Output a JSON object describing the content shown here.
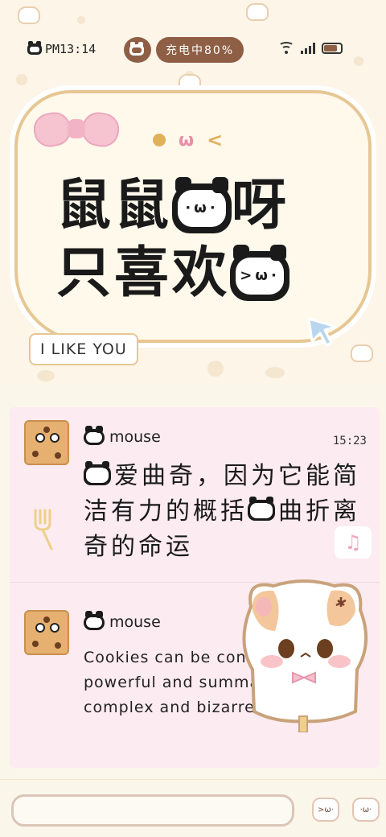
{
  "status_bar": {
    "time": "PM13:14",
    "charging": "充电中80%",
    "battery_level": 0.8
  },
  "header": {
    "title_line1": "鼠鼠",
    "title_line1_suffix": "呀",
    "title_line2": "只喜欢",
    "subtitle": "I LIKE YOU"
  },
  "chat": {
    "messages": [
      {
        "sender": "mouse",
        "time": "15:23",
        "text_part1": "爱曲奇，因为它能简洁有力的概括",
        "text_part2": "曲折离奇的命运"
      },
      {
        "sender": "mouse",
        "text": "Cookies can be concise and powerful and summarize my complex and bizarre destiny"
      }
    ]
  },
  "input": {
    "value": "",
    "placeholder": ""
  },
  "icons": {
    "status_cat": "cat-icon",
    "wifi": "wifi-icon",
    "signal": "signal-icon",
    "battery": "battery-icon",
    "input_icon_1": "cat-emoji-icon",
    "input_icon_2": "cat-sticker-icon"
  },
  "colors": {
    "accent_brown": "#8e5f45",
    "card_border": "#e6c794",
    "chat_bg": "#fcebf0",
    "bow_pink": "#f6c3d1"
  }
}
